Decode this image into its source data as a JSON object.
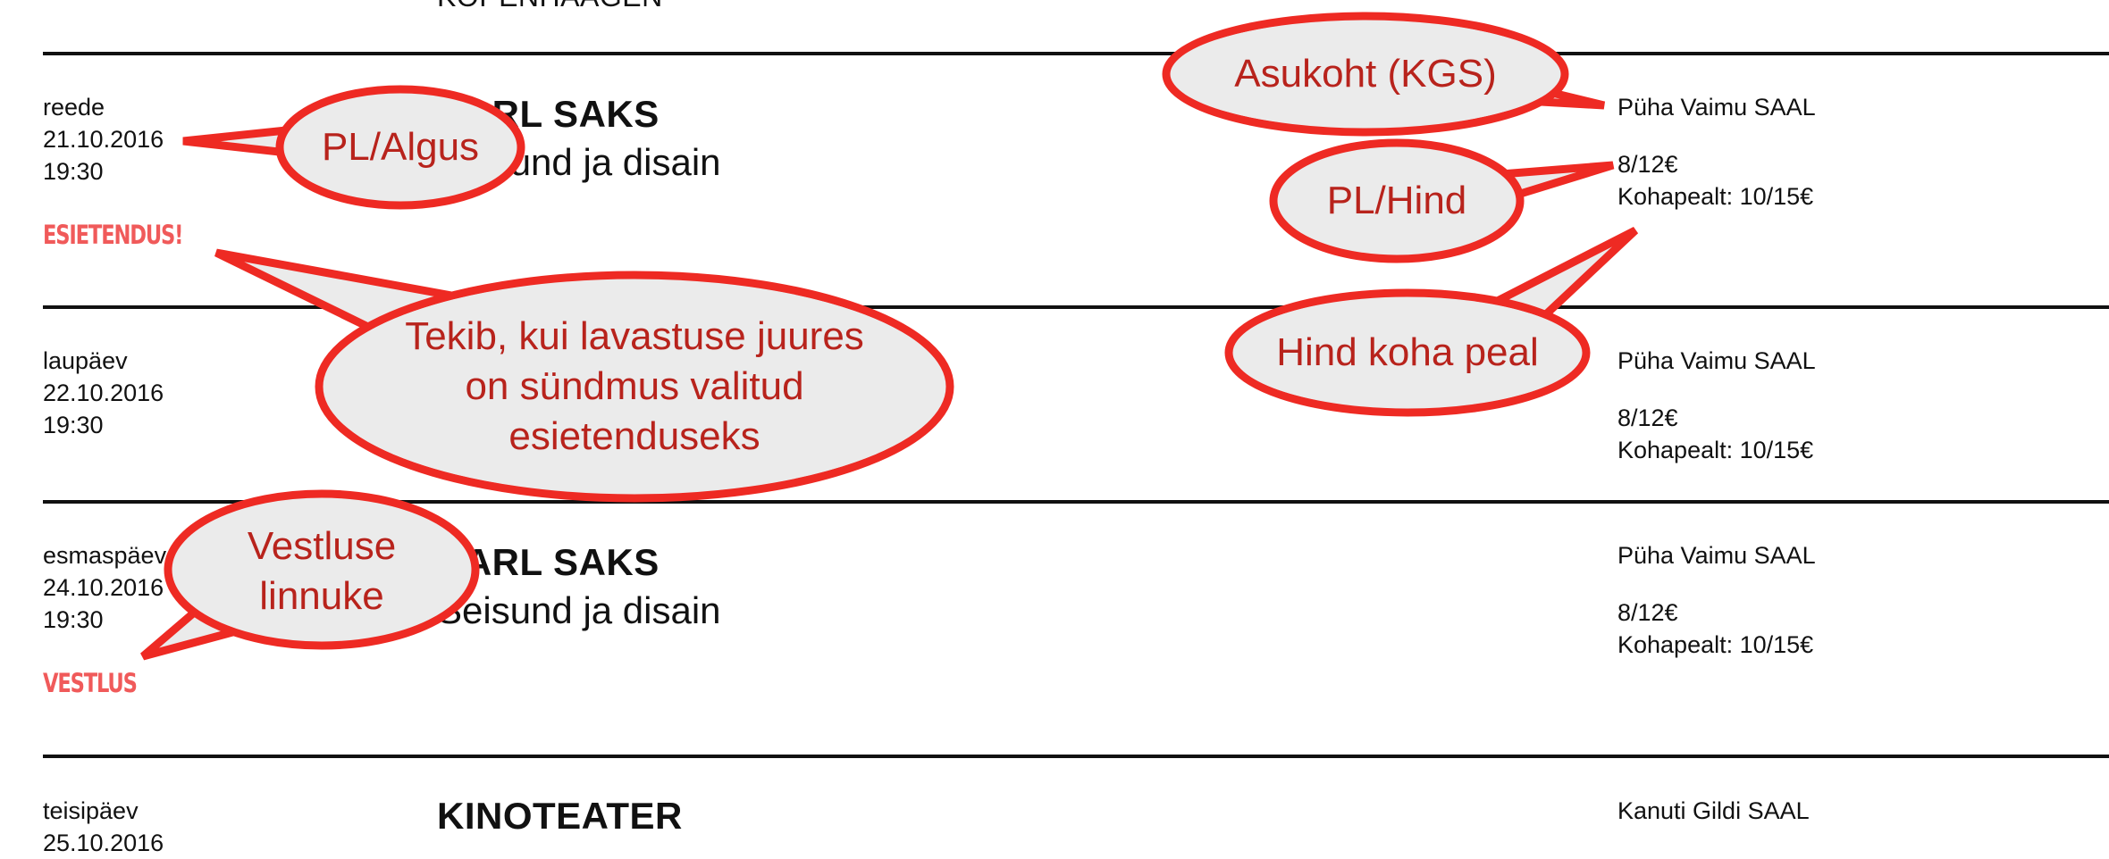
{
  "top_partial_title": "KOPENHAAGEN",
  "events": [
    {
      "day": "reede",
      "date": "21.10.2016",
      "time": "19:30",
      "badge": "ESIETENDUS!",
      "title": "KARL SAKS",
      "subtitle": "Seisund ja disain",
      "location": "Püha Vaimu SAAL",
      "price": "8/12€",
      "price_onsite": "Kohapealt: 10/15€"
    },
    {
      "day": "laupäev",
      "date": "22.10.2016",
      "time": "19:30",
      "location": "Püha Vaimu SAAL",
      "price": "8/12€",
      "price_onsite": "Kohapealt: 10/15€"
    },
    {
      "day": "esmaspäev",
      "date": "24.10.2016",
      "time": "19:30",
      "badge": "VESTLUS",
      "title": "KARL SAKS",
      "subtitle": "Seisund ja disain",
      "location": "Püha Vaimu SAAL",
      "price": "8/12€",
      "price_onsite": "Kohapealt: 10/15€"
    },
    {
      "day": "teisipäev",
      "date": "25.10.2016",
      "title": "KINOTEATER",
      "location": "Kanuti Gildi SAAL"
    }
  ],
  "annotations": {
    "asukoht": "Asukoht (KGS)",
    "pl_algus": "PL/Algus",
    "pl_hind": "PL/Hind",
    "hind_koha_peal": "Hind koha peal",
    "esietendus_note": "Tekib, kui lavastuse juures on sündmus valitud esietenduseks",
    "vestlus_note": "Vestluse linnuke"
  },
  "colors": {
    "badge": "#f05a5a",
    "annotation_text": "#b8231c",
    "annotation_stroke": "#ee2a23",
    "annotation_fill": "#ebebeb"
  }
}
